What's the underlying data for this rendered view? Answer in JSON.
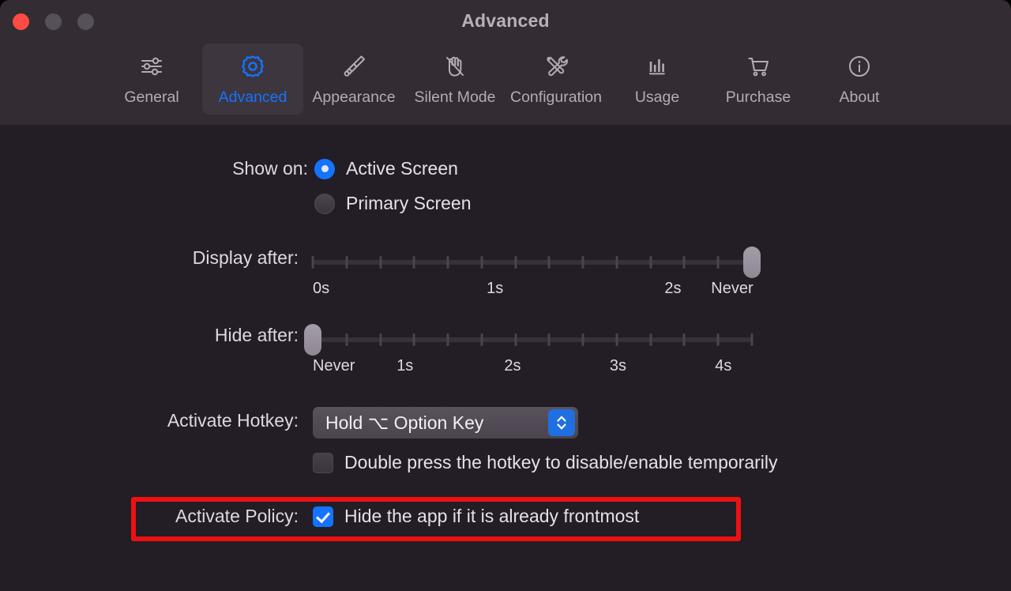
{
  "window": {
    "title": "Advanced",
    "traffic_lights": [
      "close",
      "minimize",
      "zoom"
    ]
  },
  "toolbar": {
    "tabs": [
      {
        "label": "General",
        "icon": "sliders-icon",
        "selected": false
      },
      {
        "label": "Advanced",
        "icon": "gear-icon",
        "selected": true
      },
      {
        "label": "Appearance",
        "icon": "paintbrush-icon",
        "selected": false
      },
      {
        "label": "Silent Mode",
        "icon": "hand-slash-icon",
        "selected": false
      },
      {
        "label": "Configuration",
        "icon": "tools-icon",
        "selected": false
      },
      {
        "label": "Usage",
        "icon": "bar-chart-icon",
        "selected": false
      },
      {
        "label": "Purchase",
        "icon": "shopping-cart-icon",
        "selected": false
      },
      {
        "label": "About",
        "icon": "info-circle-icon",
        "selected": false
      }
    ]
  },
  "settings": {
    "show_on": {
      "label": "Show on:",
      "options": [
        {
          "label": "Active Screen",
          "selected": true
        },
        {
          "label": "Primary Screen",
          "selected": false
        }
      ]
    },
    "display_after": {
      "label": "Display after:",
      "tick_count": 13,
      "value_index": 13,
      "scale_labels": [
        {
          "text": "0s",
          "pos": 0
        },
        {
          "text": "1s",
          "pos": 41.5
        },
        {
          "text": "2s",
          "pos": 82
        },
        {
          "text": "Never",
          "pos": 95.5
        }
      ]
    },
    "hide_after": {
      "label": "Hide after:",
      "tick_count": 13,
      "value_index": 0,
      "scale_labels": [
        {
          "text": "Never",
          "pos": 0
        },
        {
          "text": "1s",
          "pos": 21
        },
        {
          "text": "2s",
          "pos": 45.5
        },
        {
          "text": "3s",
          "pos": 69.5
        },
        {
          "text": "4s",
          "pos": 93.5
        }
      ]
    },
    "activate_hotkey": {
      "label": "Activate Hotkey:",
      "value": "Hold ⌥ Option Key",
      "double_press": {
        "label": "Double press the hotkey to disable/enable temporarily",
        "checked": false
      }
    },
    "activate_policy": {
      "label": "Activate Policy:",
      "checkbox_label": "Hide the app if it is already frontmost",
      "checked": true,
      "highlighted": true
    }
  },
  "colors": {
    "accent": "#1473ff",
    "toolbar_bg": "#332c33",
    "content_bg": "#231d26",
    "annotation": "#ee1111",
    "close_button": "#ff4b42"
  }
}
